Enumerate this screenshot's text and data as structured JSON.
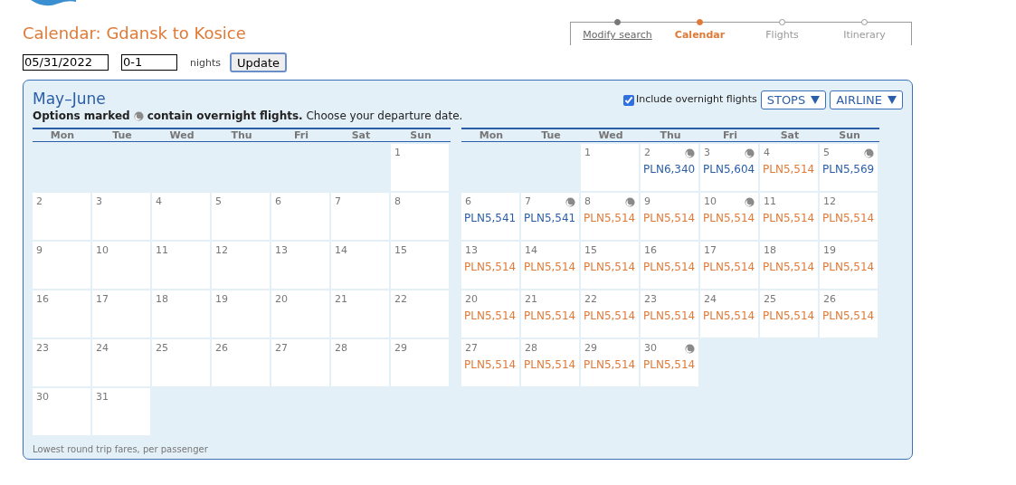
{
  "page": {
    "title": "Calendar: Gdansk to Kosice"
  },
  "steps": [
    {
      "label": "Modify search",
      "completed": true,
      "selected": false
    },
    {
      "label": "Calendar",
      "completed": false,
      "selected": true
    },
    {
      "label": "Flights",
      "completed": false,
      "selected": false
    },
    {
      "label": "Itinerary",
      "completed": false,
      "selected": false
    }
  ],
  "search": {
    "date": "05/31/2022",
    "nights": "0-1",
    "nights_label": "nights",
    "button": "Update"
  },
  "panel": {
    "title": "May–June",
    "note_before": "Options marked",
    "note_after": "**contain overnight flights.** Choose your departure date.",
    "overnight_toggle": {
      "label": "Include overnight flights",
      "checked": true
    },
    "filters": [
      {
        "label": "STOPS"
      },
      {
        "label": "AIRLINE"
      }
    ],
    "footnote": "Lowest round trip fares, per passenger",
    "months": [
      {
        "weekdays": [
          "Mon",
          "Tue",
          "Wed",
          "Thu",
          "Fri",
          "Sat",
          "Sun"
        ],
        "weeks": [
          [
            {
              "kind": "blank"
            },
            {
              "kind": "blank"
            },
            {
              "kind": "blank"
            },
            {
              "kind": "blank"
            },
            {
              "kind": "blank"
            },
            {
              "kind": "blank"
            },
            {
              "day": "1",
              "overnight": false
            }
          ],
          [
            {
              "day": "2",
              "overnight": false
            },
            {
              "day": "3",
              "overnight": false
            },
            {
              "day": "4",
              "overnight": false
            },
            {
              "day": "5",
              "overnight": false
            },
            {
              "day": "6",
              "overnight": false
            },
            {
              "day": "7",
              "overnight": false
            },
            {
              "day": "8",
              "overnight": false
            }
          ],
          [
            {
              "day": "9",
              "overnight": false
            },
            {
              "day": "10",
              "overnight": false
            },
            {
              "day": "11",
              "overnight": false
            },
            {
              "day": "12",
              "overnight": false
            },
            {
              "day": "13",
              "overnight": false
            },
            {
              "day": "14",
              "overnight": false
            },
            {
              "day": "15",
              "overnight": false
            }
          ],
          [
            {
              "day": "16",
              "overnight": false
            },
            {
              "day": "17",
              "overnight": false
            },
            {
              "day": "18",
              "overnight": false
            },
            {
              "day": "19",
              "overnight": false
            },
            {
              "day": "20",
              "overnight": false
            },
            {
              "day": "21",
              "overnight": false
            },
            {
              "day": "22",
              "overnight": false
            }
          ],
          [
            {
              "day": "23",
              "overnight": false
            },
            {
              "day": "24",
              "overnight": false
            },
            {
              "day": "25",
              "overnight": false
            },
            {
              "day": "26",
              "overnight": false
            },
            {
              "day": "27",
              "overnight": false
            },
            {
              "day": "28",
              "overnight": false
            },
            {
              "day": "29",
              "overnight": false
            }
          ],
          [
            {
              "day": "30",
              "overnight": false
            },
            {
              "day": "31",
              "overnight": false
            },
            {
              "kind": "blank"
            },
            {
              "kind": "blank"
            },
            {
              "kind": "blank"
            },
            {
              "kind": "blank"
            },
            {
              "kind": "blank"
            }
          ]
        ]
      },
      {
        "weekdays": [
          "Mon",
          "Tue",
          "Wed",
          "Thu",
          "Fri",
          "Sat",
          "Sun"
        ],
        "weeks": [
          [
            {
              "kind": "blank"
            },
            {
              "kind": "blank"
            },
            {
              "day": "1",
              "overnight": false
            },
            {
              "day": "2",
              "overnight": true,
              "fare": "PLN6,340",
              "color": "#2a5ea8"
            },
            {
              "day": "3",
              "overnight": true,
              "fare": "PLN5,604",
              "color": "#2a5ea8"
            },
            {
              "day": "4",
              "overnight": false,
              "fare": "PLN5,514",
              "color": "#e07a38"
            },
            {
              "day": "5",
              "overnight": true,
              "fare": "PLN5,569",
              "color": "#2a5ea8"
            }
          ],
          [
            {
              "day": "6",
              "overnight": false,
              "fare": "PLN5,541",
              "color": "#2a5ea8"
            },
            {
              "day": "7",
              "overnight": true,
              "fare": "PLN5,541",
              "color": "#2a5ea8"
            },
            {
              "day": "8",
              "overnight": true,
              "fare": "PLN5,514",
              "color": "#e07a38"
            },
            {
              "day": "9",
              "overnight": false,
              "fare": "PLN5,514",
              "color": "#e07a38"
            },
            {
              "day": "10",
              "overnight": true,
              "fare": "PLN5,514",
              "color": "#e07a38"
            },
            {
              "day": "11",
              "overnight": false,
              "fare": "PLN5,514",
              "color": "#e07a38"
            },
            {
              "day": "12",
              "overnight": false,
              "fare": "PLN5,514",
              "color": "#e07a38"
            }
          ],
          [
            {
              "day": "13",
              "overnight": false,
              "fare": "PLN5,514",
              "color": "#e07a38"
            },
            {
              "day": "14",
              "overnight": false,
              "fare": "PLN5,514",
              "color": "#e07a38"
            },
            {
              "day": "15",
              "overnight": false,
              "fare": "PLN5,514",
              "color": "#e07a38"
            },
            {
              "day": "16",
              "overnight": false,
              "fare": "PLN5,514",
              "color": "#e07a38"
            },
            {
              "day": "17",
              "overnight": false,
              "fare": "PLN5,514",
              "color": "#e07a38"
            },
            {
              "day": "18",
              "overnight": false,
              "fare": "PLN5,514",
              "color": "#e07a38"
            },
            {
              "day": "19",
              "overnight": false,
              "fare": "PLN5,514",
              "color": "#e07a38"
            }
          ],
          [
            {
              "day": "20",
              "overnight": false,
              "fare": "PLN5,514",
              "color": "#e07a38"
            },
            {
              "day": "21",
              "overnight": false,
              "fare": "PLN5,514",
              "color": "#e07a38"
            },
            {
              "day": "22",
              "overnight": false,
              "fare": "PLN5,514",
              "color": "#e07a38"
            },
            {
              "day": "23",
              "overnight": false,
              "fare": "PLN5,514",
              "color": "#e07a38"
            },
            {
              "day": "24",
              "overnight": false,
              "fare": "PLN5,514",
              "color": "#e07a38"
            },
            {
              "day": "25",
              "overnight": false,
              "fare": "PLN5,514",
              "color": "#e07a38"
            },
            {
              "day": "26",
              "overnight": false,
              "fare": "PLN5,514",
              "color": "#e07a38"
            }
          ],
          [
            {
              "day": "27",
              "overnight": false,
              "fare": "PLN5,514",
              "color": "#e07a38"
            },
            {
              "day": "28",
              "overnight": false,
              "fare": "PLN5,514",
              "color": "#e07a38"
            },
            {
              "day": "29",
              "overnight": false,
              "fare": "PLN5,514",
              "color": "#e07a38"
            },
            {
              "day": "30",
              "overnight": true,
              "fare": "PLN5,514",
              "color": "#e07a38"
            },
            {
              "kind": "blank"
            },
            {
              "kind": "blank"
            },
            {
              "kind": "blank"
            }
          ]
        ]
      }
    ]
  }
}
